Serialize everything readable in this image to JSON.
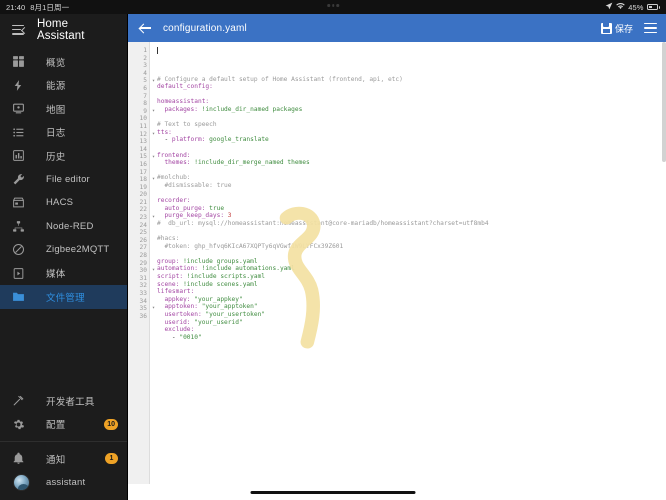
{
  "status_bar": {
    "time": "21:40",
    "date": "8月1日周一",
    "battery_percent": "45%",
    "icons": [
      "location-icon",
      "wifi-icon",
      "battery-icon"
    ]
  },
  "sidebar": {
    "title": "Home Assistant",
    "toggle_icon": "sidebar-collapse-icon",
    "items": [
      {
        "label": "概览",
        "icon": "dashboard-icon",
        "active": false,
        "badge": ""
      },
      {
        "label": "能源",
        "icon": "lightning-icon",
        "active": false,
        "badge": ""
      },
      {
        "label": "地图",
        "icon": "map-icon",
        "active": false,
        "badge": ""
      },
      {
        "label": "日志",
        "icon": "logbook-icon",
        "active": false,
        "badge": ""
      },
      {
        "label": "历史",
        "icon": "history-chart-icon",
        "active": false,
        "badge": ""
      },
      {
        "label": "File editor",
        "icon": "wrench-icon",
        "active": false,
        "badge": ""
      },
      {
        "label": "HACS",
        "icon": "store-icon",
        "active": false,
        "badge": ""
      },
      {
        "label": "Node-RED",
        "icon": "sitemap-icon",
        "active": false,
        "badge": ""
      },
      {
        "label": "Zigbee2MQTT",
        "icon": "zigbee-icon",
        "active": false,
        "badge": ""
      },
      {
        "label": "媒体",
        "icon": "media-play-icon",
        "active": false,
        "badge": ""
      },
      {
        "label": "文件管理",
        "icon": "folder-icon",
        "active": true,
        "badge": ""
      }
    ],
    "bottom_items": [
      {
        "label": "开发者工具",
        "icon": "hammer-icon",
        "badge": ""
      },
      {
        "label": "配置",
        "icon": "gear-icon",
        "badge": "10"
      }
    ],
    "footer_items": [
      {
        "label": "通知",
        "icon": "bell-icon",
        "badge": "1"
      },
      {
        "label": "assistant",
        "icon": "avatar",
        "badge": ""
      }
    ]
  },
  "topbar": {
    "back_icon": "back-arrow-icon",
    "title": "configuration.yaml",
    "save_icon": "save-floppy-icon",
    "save_label": "保存",
    "menu_icon": "hamburger-menu-icon",
    "background_color": "#3b72c4"
  },
  "editor": {
    "language": "yaml",
    "cursor_line": 1,
    "total_lines": 36,
    "annotation": {
      "type": "highlighter-stroke",
      "color": "#f5e3a0"
    },
    "lines": [
      {
        "n": 1,
        "fold": false,
        "tokens": []
      },
      {
        "n": 2,
        "fold": false,
        "tokens": [
          {
            "t": "cm",
            "v": "# Configure a default setup of Home Assistant (frontend, api, etc)"
          }
        ]
      },
      {
        "n": 3,
        "fold": false,
        "tokens": [
          {
            "t": "ky",
            "v": "default_config:"
          }
        ]
      },
      {
        "n": 4,
        "fold": false,
        "tokens": []
      },
      {
        "n": 5,
        "fold": true,
        "tokens": [
          {
            "t": "ky",
            "v": "homeassistant:"
          }
        ]
      },
      {
        "n": 6,
        "fold": false,
        "tokens": [
          {
            "t": "ky",
            "v": "  packages:"
          },
          {
            "t": "st",
            "v": " !include_dir_named packages"
          }
        ]
      },
      {
        "n": 7,
        "fold": false,
        "tokens": []
      },
      {
        "n": 8,
        "fold": false,
        "tokens": [
          {
            "t": "cm",
            "v": "# Text to speech"
          }
        ]
      },
      {
        "n": 9,
        "fold": true,
        "tokens": [
          {
            "t": "ky",
            "v": "tts:"
          }
        ]
      },
      {
        "n": 10,
        "fold": false,
        "tokens": [
          {
            "t": "pl",
            "v": "  - "
          },
          {
            "t": "ky",
            "v": "platform:"
          },
          {
            "t": "st",
            "v": " google_translate"
          }
        ]
      },
      {
        "n": 11,
        "fold": false,
        "tokens": []
      },
      {
        "n": 12,
        "fold": true,
        "tokens": [
          {
            "t": "ky",
            "v": "frontend:"
          }
        ]
      },
      {
        "n": 13,
        "fold": false,
        "tokens": [
          {
            "t": "ky",
            "v": "  themes:"
          },
          {
            "t": "st",
            "v": " !include_dir_merge_named themes"
          }
        ]
      },
      {
        "n": 14,
        "fold": false,
        "tokens": []
      },
      {
        "n": 15,
        "fold": true,
        "tokens": [
          {
            "t": "cm",
            "v": "#molchub:"
          }
        ]
      },
      {
        "n": 16,
        "fold": false,
        "tokens": [
          {
            "t": "cm",
            "v": "  #dismissable: true"
          }
        ]
      },
      {
        "n": 17,
        "fold": false,
        "tokens": []
      },
      {
        "n": 18,
        "fold": true,
        "tokens": [
          {
            "t": "ky",
            "v": "recorder:"
          }
        ]
      },
      {
        "n": 19,
        "fold": false,
        "tokens": [
          {
            "t": "ky",
            "v": "  auto_purge:"
          },
          {
            "t": "st",
            "v": " true"
          }
        ]
      },
      {
        "n": 20,
        "fold": false,
        "tokens": [
          {
            "t": "ky",
            "v": "  purge_keep_days:"
          },
          {
            "t": "nu",
            "v": " 3"
          }
        ]
      },
      {
        "n": 21,
        "fold": false,
        "tokens": [
          {
            "t": "cm",
            "v": "#  db_url: mysql://homeassistant:homeassistant@core-mariadb/homeassistant?charset=utf8mb4"
          }
        ]
      },
      {
        "n": 22,
        "fold": false,
        "tokens": []
      },
      {
        "n": 23,
        "fold": true,
        "tokens": [
          {
            "t": "cm",
            "v": "#hacs:"
          }
        ]
      },
      {
        "n": 24,
        "fold": false,
        "tokens": [
          {
            "t": "cm",
            "v": "  #token: ghp_hfvq6KIcA67XQPTy6qVGwf1W9LYFCx39Z601"
          }
        ]
      },
      {
        "n": 25,
        "fold": false,
        "tokens": []
      },
      {
        "n": 26,
        "fold": false,
        "tokens": [
          {
            "t": "ky",
            "v": "group:"
          },
          {
            "t": "st",
            "v": " !include groups.yaml"
          }
        ]
      },
      {
        "n": 27,
        "fold": false,
        "tokens": [
          {
            "t": "ky",
            "v": "automation:"
          },
          {
            "t": "st",
            "v": " !include automations.yaml"
          }
        ]
      },
      {
        "n": 28,
        "fold": false,
        "tokens": [
          {
            "t": "ky",
            "v": "script:"
          },
          {
            "t": "st",
            "v": " !include scripts.yaml"
          }
        ]
      },
      {
        "n": 29,
        "fold": false,
        "tokens": [
          {
            "t": "ky",
            "v": "scene:"
          },
          {
            "t": "st",
            "v": " !include scenes.yaml"
          }
        ]
      },
      {
        "n": 30,
        "fold": true,
        "tokens": [
          {
            "t": "ky",
            "v": "lifesmart:"
          }
        ]
      },
      {
        "n": 31,
        "fold": false,
        "tokens": [
          {
            "t": "ky",
            "v": "  appkey:"
          },
          {
            "t": "qs",
            "v": " \"your_appkey\""
          }
        ]
      },
      {
        "n": 32,
        "fold": false,
        "tokens": [
          {
            "t": "ky",
            "v": "  apptoken:"
          },
          {
            "t": "qs",
            "v": " \"your_apptoken\""
          }
        ]
      },
      {
        "n": 33,
        "fold": false,
        "tokens": [
          {
            "t": "ky",
            "v": "  usertoken:"
          },
          {
            "t": "qs",
            "v": " \"your_usertoken\""
          }
        ]
      },
      {
        "n": 34,
        "fold": false,
        "tokens": [
          {
            "t": "ky",
            "v": "  userid:"
          },
          {
            "t": "qs",
            "v": " \"your_userid\""
          }
        ]
      },
      {
        "n": 35,
        "fold": true,
        "tokens": [
          {
            "t": "ky",
            "v": "  exclude:"
          }
        ]
      },
      {
        "n": 36,
        "fold": false,
        "tokens": [
          {
            "t": "pl",
            "v": "    - "
          },
          {
            "t": "qs",
            "v": "\"0010\""
          }
        ]
      }
    ]
  },
  "system_nav": {
    "home_indicator": true
  }
}
